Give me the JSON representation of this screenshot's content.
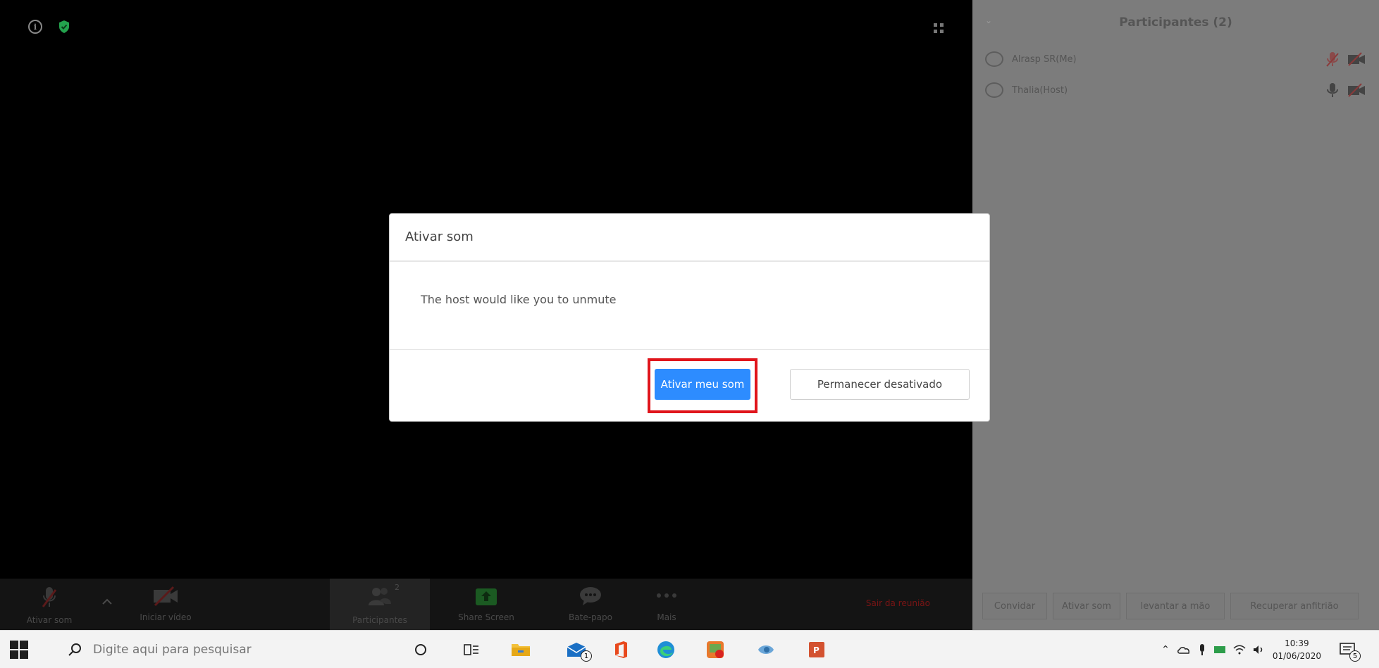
{
  "meeting": {
    "toolbar": {
      "unmute_label": "Ativar som",
      "start_video_label": "Iniciar vídeo",
      "participants_label": "Participantes",
      "participants_count": "2",
      "share_screen_label": "Share Screen",
      "chat_label": "Bate-papo",
      "more_label": "Mais",
      "leave_label": "Sair da reunião"
    }
  },
  "participants_panel": {
    "title": "Participantes (2)",
    "participants": [
      {
        "name": "Alrasp SR(Me)"
      },
      {
        "name": "Thalia(Host)"
      }
    ],
    "buttons": {
      "invite": "Convidar",
      "unmute": "Ativar som",
      "raise_hand": "levantar a mão",
      "reclaim_host": "Recuperar anfitrião"
    }
  },
  "dialog": {
    "title": "Ativar som",
    "message": "The host would like you to unmute",
    "primary_button": "Ativar meu som",
    "secondary_button": "Permanecer desativado"
  },
  "taskbar": {
    "search_placeholder": "Digite aqui para pesquisar",
    "time": "10:39",
    "date": "01/06/2020",
    "mail_badge": "1",
    "notification_badge": "5"
  },
  "colors": {
    "accent": "#2d8cff",
    "highlight": "#e0151c",
    "leave": "#c0151c"
  }
}
